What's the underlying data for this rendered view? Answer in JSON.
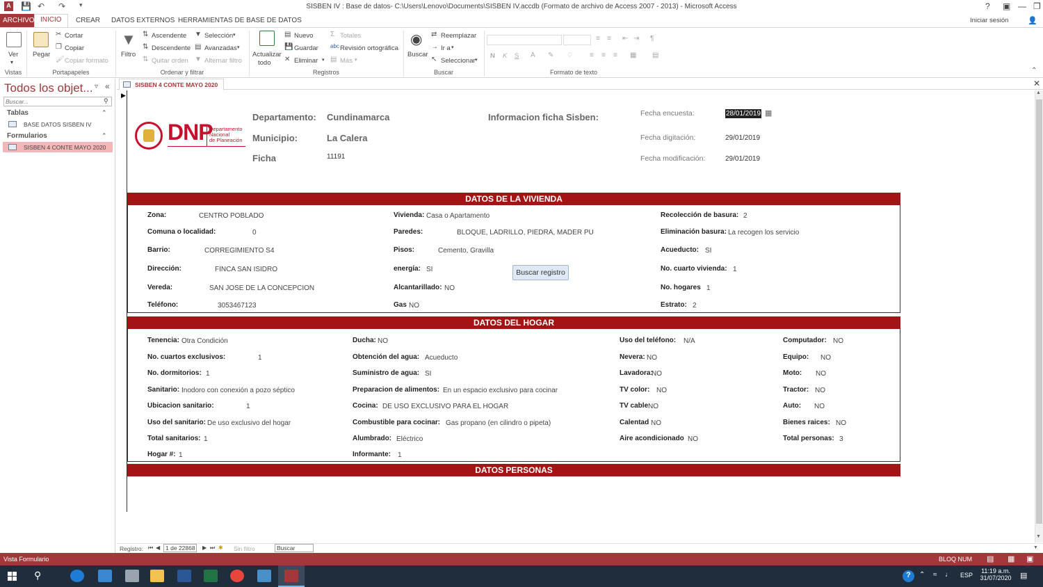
{
  "window": {
    "title": "SISBEN IV : Base de datos- C:\\Users\\Lenovo\\Documents\\SISBEN IV.accdb (Formato de archivo de Access 2007 - 2013) - Microsoft Access",
    "help": "?",
    "signin": "Iniciar sesión"
  },
  "tabs": {
    "file": "ARCHIVO",
    "home": "INICIO",
    "create": "CREAR",
    "external": "DATOS EXTERNOS",
    "tools": "HERRAMIENTAS DE BASE DE DATOS"
  },
  "ribbon": {
    "views": {
      "ver": "Ver",
      "group": "Vistas"
    },
    "clipboard": {
      "pegar": "Pegar",
      "cortar": "Cortar",
      "copiar": "Copiar",
      "copiar_formato": "Copiar formato",
      "group": "Portapapeles"
    },
    "sort": {
      "filtro": "Filtro",
      "ascendente": "Ascendente",
      "descendente": "Descendente",
      "quitar_orden": "Quitar orden",
      "seleccion": "Selección",
      "avanzadas": "Avanzadas",
      "alternar": "Alternar filtro",
      "group": "Ordenar y filtrar"
    },
    "records": {
      "actualizar1": "Actualizar",
      "actualizar2": "todo",
      "nuevo": "Nuevo",
      "guardar": "Guardar",
      "eliminar": "Eliminar",
      "totales": "Totales",
      "ortografia": "Revisión ortográfica",
      "mas": "Más",
      "group": "Registros"
    },
    "find": {
      "buscar": "Buscar",
      "reemplazar": "Reemplazar",
      "ira": "Ir a",
      "seleccionar": "Seleccionar",
      "group": "Buscar"
    },
    "format": {
      "n": "N",
      "k": "K",
      "s": "S",
      "group": "Formato de texto"
    }
  },
  "nav": {
    "header": "Todos los objet...",
    "search_placeholder": "Buscar...",
    "sections": [
      {
        "title": "Tablas",
        "items": [
          "BASE DATOS SISBEN IV"
        ]
      },
      {
        "title": "Formularios",
        "items": [
          "SISBEN 4 CONTE MAYO 2020"
        ]
      }
    ]
  },
  "doc_tab": "SISBEN 4 CONTE MAYO 2020",
  "logo": {
    "text": "DNP",
    "sub": [
      "Departamento",
      "Nacional",
      "de Planeación"
    ],
    "brand_color": "#c8102e"
  },
  "header": {
    "departamento_label": "Departamento:",
    "departamento": "Cundinamarca",
    "municipio_label": "Municipio:",
    "municipio": "La Calera",
    "ficha_label": "Ficha",
    "ficha": "11191",
    "info_label": "Informacion ficha Sisben:",
    "fecha_encuesta_label": "Fecha encuesta:",
    "fecha_encuesta": "28/01/2019",
    "fecha_digitacion_label": "Fecha digitación:",
    "fecha_digitacion": "29/01/2019",
    "fecha_modificacion_label": "Fecha modificación:",
    "fecha_modificacion": "29/01/2019"
  },
  "vivienda": {
    "title": "DATOS DE LA VIVIENDA",
    "fields": [
      {
        "label": "Zona:",
        "value": "CENTRO POBLADO"
      },
      {
        "label": "Comuna o localidad:",
        "value": "0"
      },
      {
        "label": "Barrio:",
        "value": "CORREGIMIENTO S4"
      },
      {
        "label": "Dirección:",
        "value": "FINCA SAN ISIDRO"
      },
      {
        "label": "Vereda:",
        "value": "SAN JOSE DE LA CONCEPCION"
      },
      {
        "label": "Teléfono:",
        "value": "3053467123"
      },
      {
        "label": "Vivienda:",
        "value": "Casa o Apartamento"
      },
      {
        "label": "Paredes:",
        "value": "BLOQUE, LADRILLO, PIEDRA, MADER PU"
      },
      {
        "label": "Pisos:",
        "value": "Cemento, Gravilla"
      },
      {
        "label": "energía:",
        "value": "SI"
      },
      {
        "label": "Alcantarillado:",
        "value": "NO"
      },
      {
        "label": "Gas",
        "value": "NO"
      },
      {
        "label": "Recolección de basura:",
        "value": "2"
      },
      {
        "label": "Eliminación basura:",
        "value": "La recogen los servicio"
      },
      {
        "label": "Acueducto:",
        "value": "SI"
      },
      {
        "label": "No. cuarto vivienda:",
        "value": "1"
      },
      {
        "label": "No. hogares",
        "value": "1"
      },
      {
        "label": "Estrato:",
        "value": "2"
      }
    ],
    "buscar_btn": "Buscar registro"
  },
  "hogar": {
    "title": "DATOS DEL HOGAR",
    "fields": [
      {
        "label": "Tenencia:",
        "value": "Otra Condición"
      },
      {
        "label": "No. cuartos exclusivos:",
        "value": "1"
      },
      {
        "label": "No. dormitorios:",
        "value": "1"
      },
      {
        "label": "Sanitario:",
        "value": "Inodoro con conexión a pozo séptico"
      },
      {
        "label": "Ubicacion sanitario:",
        "value": "1"
      },
      {
        "label": "Uso del sanitario:",
        "value": "De uso exclusivo del hogar"
      },
      {
        "label": "Total sanitarios:",
        "value": "1"
      },
      {
        "label": "Hogar #:",
        "value": "1"
      },
      {
        "label": "Ducha:",
        "value": "NO"
      },
      {
        "label": "Obtención del agua:",
        "value": "Acueducto"
      },
      {
        "label": "Suministro de agua:",
        "value": "SI"
      },
      {
        "label": "Preparacion de alimentos:",
        "value": "En un espacio exclusivo para cocinar"
      },
      {
        "label": "Cocina:",
        "value": "DE USO EXCLUSIVO PARA EL HOGAR"
      },
      {
        "label": "Combustible para cocinar:",
        "value": "Gas propano (en cilindro o pipeta)"
      },
      {
        "label": "Alumbrado:",
        "value": "Eléctrico"
      },
      {
        "label": "Informante:",
        "value": "1"
      },
      {
        "label": "Uso del teléfono:",
        "value": "N/A"
      },
      {
        "label": "Nevera:",
        "value": "NO"
      },
      {
        "label": "Lavadora:",
        "value": "NO"
      },
      {
        "label": "TV color:",
        "value": "NO"
      },
      {
        "label": "TV cable",
        "value": "NO"
      },
      {
        "label": "Calentad",
        "value": "NO"
      },
      {
        "label": "Aire acondicionado",
        "value": "NO"
      },
      {
        "label": "Computador:",
        "value": "NO"
      },
      {
        "label": "Equipo:",
        "value": "NO"
      },
      {
        "label": "Moto:",
        "value": "NO"
      },
      {
        "label": "Tractor:",
        "value": "NO"
      },
      {
        "label": "Auto:",
        "value": "NO"
      },
      {
        "label": "Bienes raices:",
        "value": "NO"
      },
      {
        "label": "Total personas:",
        "value": "3"
      }
    ]
  },
  "personas": {
    "title": "DATOS PERSONAS"
  },
  "recnav": {
    "label": "Registro:",
    "position": "1 de 22868",
    "nofilter": "Sin filtro",
    "search": "Buscar"
  },
  "status": {
    "left": "Vista Formulario",
    "right": "BLOQ NUM"
  },
  "taskbar": {
    "lang": "ESP",
    "time": "11:19 a.m.",
    "date": "31/07/2020"
  }
}
